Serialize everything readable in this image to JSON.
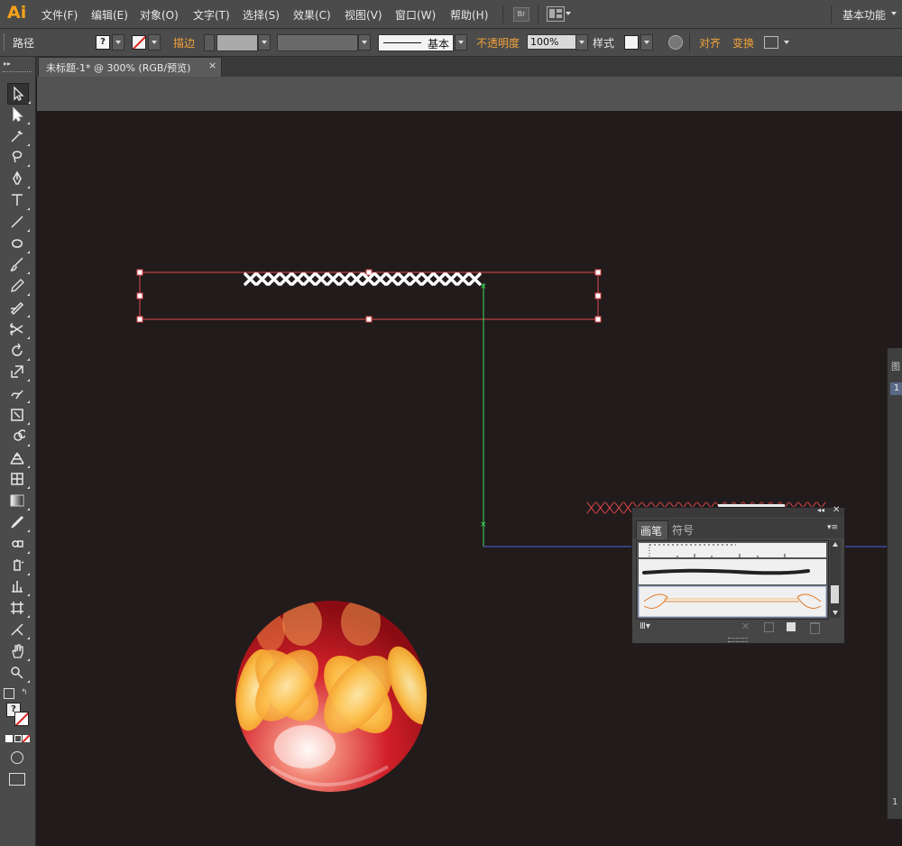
{
  "app": {
    "logo": "Ai",
    "workspace": "基本功能"
  },
  "menu": [
    "文件(F)",
    "编辑(E)",
    "对象(O)",
    "文字(T)",
    "选择(S)",
    "效果(C)",
    "视图(V)",
    "窗口(W)",
    "帮助(H)"
  ],
  "bridge_label": "Br",
  "control": {
    "object_type": "路径",
    "stroke_label": "描边",
    "brush_name": "基本",
    "opacity_label": "不透明度",
    "opacity_value": "100%",
    "style_label": "样式",
    "align_label": "对齐",
    "transform_label": "变换",
    "fill_swatch": "?"
  },
  "document": {
    "tab_title": "未标题-1* @ 300% (RGB/预览)",
    "close": "×"
  },
  "tools": [
    "selection-tool",
    "direct-selection-tool",
    "magic-wand-tool",
    "lasso-tool",
    "pen-tool",
    "type-tool",
    "line-segment-tool",
    "ellipse-tool",
    "paintbrush-tool",
    "pencil-tool",
    "blob-brush-tool",
    "scissors-tool",
    "rotate-tool",
    "scale-tool",
    "warp-tool",
    "free-transform-tool",
    "shape-builder-tool",
    "perspective-grid-tool",
    "mesh-tool",
    "gradient-tool",
    "eyedropper-tool",
    "blend-tool",
    "symbol-sprayer-tool",
    "column-graph-tool",
    "artboard-tool",
    "slice-tool",
    "hand-tool",
    "zoom-tool"
  ],
  "brush_panel": {
    "tabs": [
      "画笔",
      "符号"
    ],
    "active_tab": "画笔"
  },
  "right_dock": {
    "top_label": "图",
    "item": "1",
    "bottom": "1"
  },
  "colors": {
    "accent": "#f7a21b",
    "selection": "#e0484d",
    "guide_green": "#3ddc5a",
    "guide_blue": "#4d5fe0",
    "canvas": "#221b1b"
  }
}
